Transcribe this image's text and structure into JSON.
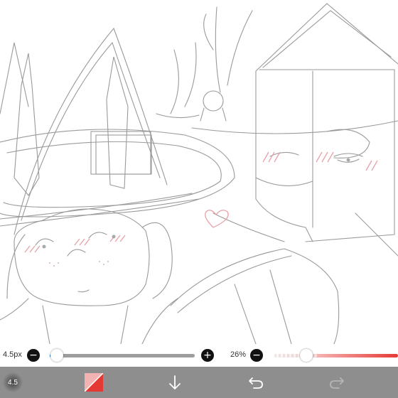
{
  "brush_size": {
    "value_label": "4.5px",
    "minus_label": "−",
    "plus_label": "+",
    "level": 0.05
  },
  "opacity": {
    "value_label": "26%",
    "minus_label": "−",
    "level": 0.26
  },
  "toolbar": {
    "brush_preview_label": "4.5",
    "items": [
      {
        "name": "brush-size-preview",
        "icon": "brush-preview-icon"
      },
      {
        "name": "color-swatch",
        "icon": "color-swatch-icon"
      },
      {
        "name": "layer-down-button",
        "icon": "arrow-down-icon"
      },
      {
        "name": "undo-button",
        "icon": "undo-icon"
      },
      {
        "name": "redo-button",
        "icon": "redo-icon"
      }
    ]
  },
  "colors": {
    "accent": "#e53935",
    "toolbar_bg": "#8e8e8e",
    "slider_track": "#9e9e9e",
    "slider_fill": "#1e88e5",
    "sketch_line": "#9a9a9a",
    "blush": "#e8a0a8"
  }
}
